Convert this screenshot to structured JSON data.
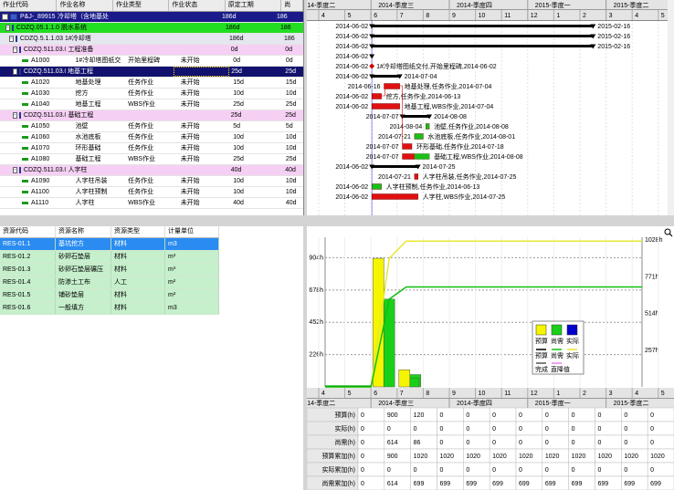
{
  "activity_table": {
    "columns": [
      "作业代码",
      "作业名称",
      "作业类型",
      "作业状态",
      "原定工期",
      "尚"
    ],
    "rows": [
      {
        "kind": "root",
        "code": "P&J-_89915",
        "name": "冷却塔（含地基处",
        "type": "",
        "status": "",
        "dur": "186d",
        "extra": "186"
      },
      {
        "kind": "green",
        "code": "CDZQ.05.1.1.05",
        "name": "脱水系统",
        "type": "",
        "status": "",
        "dur": "186d",
        "extra": "186"
      },
      {
        "kind": "grey",
        "code": "CDZQ.5.1.1.03",
        "name": "1#冷却塔",
        "type": "",
        "status": "",
        "dur": "186d",
        "extra": "186"
      },
      {
        "kind": "pink",
        "code": "CDZQ.511.03.01",
        "name": "工程准备",
        "type": "",
        "status": "",
        "dur": "0d",
        "extra": "0d"
      },
      {
        "kind": "leaf",
        "code": "A1000",
        "name": "1#冷却塔图纸交",
        "type": "开始里程碑",
        "status": "未开始",
        "dur": "0d",
        "extra": "0d"
      },
      {
        "kind": "sel",
        "code": "CDZQ.511.03.02",
        "name": "地基工程",
        "type": "",
        "status": "",
        "dur": "25d",
        "extra": "25d"
      },
      {
        "kind": "leaf",
        "code": "A1020",
        "name": "地基处理",
        "type": "任务作业",
        "status": "未开始",
        "dur": "15d",
        "extra": "15d"
      },
      {
        "kind": "leaf",
        "code": "A1030",
        "name": "挖方",
        "type": "任务作业",
        "status": "未开始",
        "dur": "10d",
        "extra": "10d"
      },
      {
        "kind": "leaf",
        "code": "A1040",
        "name": "地基工程",
        "type": "WBS作业",
        "status": "未开始",
        "dur": "25d",
        "extra": "25d"
      },
      {
        "kind": "pink",
        "code": "CDZQ.511.03.002",
        "name": "基础工程",
        "type": "",
        "status": "",
        "dur": "25d",
        "extra": "25d"
      },
      {
        "kind": "leaf",
        "code": "A1050",
        "name": "池壁",
        "type": "任务作业",
        "status": "未开始",
        "dur": "5d",
        "extra": "5d"
      },
      {
        "kind": "leaf",
        "code": "A1060",
        "name": "水池底板",
        "type": "任务作业",
        "status": "未开始",
        "dur": "10d",
        "extra": "10d"
      },
      {
        "kind": "leaf",
        "code": "A1070",
        "name": "环形基础",
        "type": "任务作业",
        "status": "未开始",
        "dur": "10d",
        "extra": "10d"
      },
      {
        "kind": "leaf",
        "code": "A1080",
        "name": "基础工程",
        "type": "WBS作业",
        "status": "未开始",
        "dur": "25d",
        "extra": "25d"
      },
      {
        "kind": "pink",
        "code": "CDZQ.511.03.03",
        "name": "人字柱",
        "type": "",
        "status": "",
        "dur": "40d",
        "extra": "40d"
      },
      {
        "kind": "leaf",
        "code": "A1090",
        "name": "人字柱吊装",
        "type": "任务作业",
        "status": "未开始",
        "dur": "10d",
        "extra": "10d"
      },
      {
        "kind": "leaf",
        "code": "A1100",
        "name": "人字柱预制",
        "type": "任务作业",
        "status": "未开始",
        "dur": "10d",
        "extra": "10d"
      },
      {
        "kind": "leaf",
        "code": "A1110",
        "name": "人字柱",
        "type": "WBS作业",
        "status": "未开始",
        "dur": "40d",
        "extra": "40d"
      }
    ]
  },
  "gantt": {
    "quarter_header": [
      "2014-季度二",
      "2014-季度三",
      "2014-季度四",
      "2015-季度一",
      "2015-季度二"
    ],
    "month_header": [
      "4",
      "5",
      "6",
      "7",
      "8",
      "9",
      "10",
      "11",
      "12",
      "1",
      "2",
      "3",
      "4",
      "5"
    ],
    "labels": [
      {
        "left": "2014-06-02",
        "right": "2015-02-16"
      },
      {
        "left": "2014-06-02",
        "right": "2015-02-16"
      },
      {
        "left": "2014-06-02",
        "right": "2015-02-16"
      },
      {
        "left": "2014-06-02",
        "right": ""
      },
      {
        "left": "2014-06-02",
        "right": "1#冷却塔图纸交付,开始里程碑,2014-06-02"
      },
      {
        "left": "2014-06-02",
        "right": "2014-07-04"
      },
      {
        "left": "2014-06-16",
        "right": "地基处理,任务作业,2014-07-04"
      },
      {
        "left": "2014-06-02",
        "right": "挖方,任务作业,2014-06-13"
      },
      {
        "left": "2014-06-02",
        "right": "地基工程,WBS作业,2014-07-04"
      },
      {
        "left": "2014-07-07",
        "right": "2014-08-08"
      },
      {
        "left": "2014-08-04",
        "right": "池壁,任务作业,2014-08-08"
      },
      {
        "left": "2014-07-21",
        "right": "水池底板,任务作业,2014-08-01"
      },
      {
        "left": "2014-07-07",
        "right": "环形基础,任务作业,2014-07-18"
      },
      {
        "left": "2014-07-07",
        "right": "基础工程,WBS作业,2014-08-08"
      },
      {
        "left": "2014-06-02",
        "right": "2014-07-25"
      },
      {
        "left": "2014-07-21",
        "right": "人字柱吊装,任务作业,2014-07-25"
      },
      {
        "left": "2014-06-02",
        "right": "人字柱预制,任务作业,2014-06-13"
      },
      {
        "left": "2014-06-02",
        "right": "人字柱,WBS作业,2014-07-25"
      }
    ]
  },
  "resources": {
    "columns": [
      "资源代码",
      "资源名称",
      "资源类型",
      "计量单位"
    ],
    "rows": [
      {
        "code": "RES-01.1",
        "name": "基坑挖方",
        "type": "材料",
        "unit": "m3"
      },
      {
        "code": "RES-01.2",
        "name": "砂卵石垫层",
        "type": "材料",
        "unit": "m³"
      },
      {
        "code": "RES-01.3",
        "name": "砂卵石垫层碾压",
        "type": "材料",
        "unit": "m³"
      },
      {
        "code": "RES-01.4",
        "name": "防渗土工布",
        "type": "人工",
        "unit": "m²"
      },
      {
        "code": "RES-01.5",
        "name": "铺砂垫层",
        "type": "材料",
        "unit": "m²"
      },
      {
        "code": "RES-01.6",
        "name": "一般填方",
        "type": "材料",
        "unit": "m3"
      }
    ]
  },
  "chart_data": {
    "type": "bar",
    "categories": [
      "4",
      "5",
      "6",
      "7",
      "8",
      "9",
      "10",
      "11",
      "12",
      "1",
      "2",
      "3",
      "4",
      "5"
    ],
    "series": [
      {
        "name": "预算",
        "values": [
          0,
          0,
          900,
          120,
          0,
          0,
          0,
          0,
          0,
          0,
          0,
          0,
          0,
          0
        ]
      },
      {
        "name": "尚需",
        "values": [
          0,
          0,
          614,
          86,
          0,
          0,
          0,
          0,
          0,
          0,
          0,
          0,
          0,
          0
        ]
      },
      {
        "name": "实际",
        "values": [
          0,
          0,
          0,
          0,
          0,
          0,
          0,
          0,
          0,
          0,
          0,
          0,
          0,
          0
        ]
      }
    ],
    "cumulative": [
      {
        "name": "预算",
        "values": [
          0,
          0,
          900,
          1020,
          1020,
          1020,
          1020,
          1020,
          1020,
          1020,
          1020,
          1020,
          1020,
          1020
        ]
      },
      {
        "name": "尚需",
        "values": [
          0,
          0,
          614,
          699,
          699,
          699,
          699,
          699,
          699,
          699,
          699,
          699,
          699,
          699
        ]
      }
    ],
    "left_ticks": [
      "904h",
      "678h",
      "452h",
      "226h"
    ],
    "right_ticks": [
      "1028h",
      "771h",
      "514h",
      "257h"
    ],
    "ylim": [
      0,
      1028
    ],
    "legend": {
      "items": [
        "预算",
        "尚需",
        "实际"
      ],
      "lines": [
        "预算",
        "尚需",
        "实际",
        "完成",
        "直降值"
      ]
    },
    "quarter_header": [
      "2014-季度二",
      "2014-季度三",
      "2014-季度四",
      "2015-季度一",
      "2015-季度二"
    ],
    "table_rows": [
      {
        "label": "预算(h)",
        "values": [
          "0",
          "900",
          "120",
          "0",
          "0",
          "0",
          "0",
          "0",
          "0",
          "0",
          "0",
          "0"
        ]
      },
      {
        "label": "实际(h)",
        "values": [
          "0",
          "0",
          "0",
          "0",
          "0",
          "0",
          "0",
          "0",
          "0",
          "0",
          "0",
          "0"
        ]
      },
      {
        "label": "尚需(h)",
        "values": [
          "0",
          "614",
          "86",
          "0",
          "0",
          "0",
          "0",
          "0",
          "0",
          "0",
          "0",
          "0"
        ]
      },
      {
        "label": "预算累加(h)",
        "values": [
          "0",
          "900",
          "1020",
          "1020",
          "1020",
          "1020",
          "1020",
          "1020",
          "1020",
          "1020",
          "1020",
          "1020"
        ]
      },
      {
        "label": "实际累加(h)",
        "values": [
          "0",
          "0",
          "0",
          "0",
          "0",
          "0",
          "0",
          "0",
          "0",
          "0",
          "0",
          "0"
        ]
      },
      {
        "label": "尚需累加(h)",
        "values": [
          "0",
          "614",
          "699",
          "699",
          "699",
          "699",
          "699",
          "699",
          "699",
          "699",
          "699",
          "699"
        ]
      }
    ],
    "colors": {
      "budget": "#f5f500",
      "remaining": "#18d018",
      "actual": "#0000cc",
      "line_budget": "#e8e830",
      "line_remaining": "#10c010"
    }
  }
}
